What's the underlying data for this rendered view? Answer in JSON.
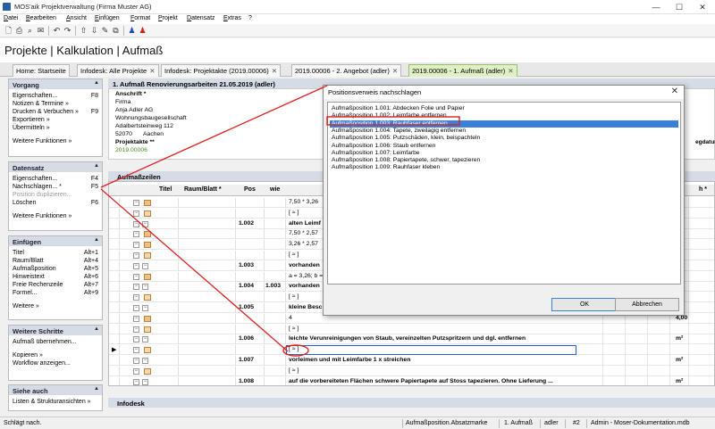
{
  "window": {
    "title": "MOS'aik Projektverwaltung (Firma Muster AG)",
    "min": "—",
    "max": "☐",
    "close": "✕"
  },
  "menu": [
    "Datei",
    "Bearbeiten",
    "Ansicht",
    "Einfügen",
    "Format",
    "Projekt",
    "Datensatz",
    "Extras",
    "?"
  ],
  "toolbar": {
    "icons": [
      "new-doc-icon",
      "print-icon",
      "preview-icon",
      "mail-icon",
      "undo-icon",
      "redo-icon",
      "arrow-up-icon",
      "arrow-down-icon",
      "edit-icon",
      "copy-icon",
      "user-blue-icon",
      "user-red-icon"
    ]
  },
  "app_title": "Projekte | Kalkulation | Aufmaß",
  "tabs": [
    {
      "label": "Home: Startseite",
      "close": ""
    },
    {
      "label": "Infodesk: Alle Projekte",
      "close": "✕"
    },
    {
      "label": "Infodesk: Projektakte (2019.00006)",
      "close": "✕"
    },
    {
      "label": "2019.00006 - 2. Angebot (adler)",
      "close": "✕"
    },
    {
      "label": "2019.00006 - 1. Aufmaß (adler)",
      "close": "✕"
    }
  ],
  "sidebar": {
    "vorgang": {
      "title": "Vorgang",
      "items": [
        {
          "label": "Eigenschaften...",
          "key": "F8"
        },
        {
          "label": "Notizen & Termine »",
          "key": ""
        },
        {
          "label": "Drucken & Verbuchen »",
          "key": "F9"
        },
        {
          "label": "Exportieren »",
          "key": ""
        },
        {
          "label": "Übermitteln »",
          "key": ""
        }
      ],
      "more": "Weitere Funktionen »"
    },
    "datensatz": {
      "title": "Datensatz",
      "items": [
        {
          "label": "Eigenschaften...",
          "key": "F4"
        },
        {
          "label": "Nachschlagen... *",
          "key": "F5"
        },
        {
          "label": "Position duplizieren...",
          "key": ""
        },
        {
          "label": "Löschen",
          "key": "F6"
        }
      ],
      "more": "Weitere Funktionen »"
    },
    "einfuegen": {
      "title": "Einfügen",
      "items": [
        {
          "label": "Titel",
          "key": "Alt+1"
        },
        {
          "label": "Raum/Blatt",
          "key": "Alt+4"
        },
        {
          "label": "Aufmaßposition",
          "key": "Alt+5"
        },
        {
          "label": "Hinweistext",
          "key": "Alt+6"
        },
        {
          "label": "Freie Rechenzeile",
          "key": "Alt+7"
        },
        {
          "label": "Formel...",
          "key": "Alt+9"
        }
      ],
      "more": "Weitere »"
    },
    "schritte": {
      "title": "Weitere Schritte",
      "items": [
        {
          "label": "Aufmaß übernehmen...",
          "key": ""
        },
        {
          "label": "Kopieren »",
          "key": ""
        },
        {
          "label": "Workflow anzeigen...",
          "key": ""
        }
      ]
    },
    "siehe": {
      "title": "Siehe auch",
      "items": [
        {
          "label": "Listen & Strukturansichten »",
          "key": ""
        }
      ]
    }
  },
  "main": {
    "header": "1. Aufmaß Renovierungsarbeiten 21.05.2019 (adler)",
    "address_label": "Anschrift *",
    "address_lines": [
      "Firma",
      "Anja Adler AG",
      "Wohnungsbaugesellschaft",
      "Adalbertsteinweg 112"
    ],
    "zip": "52070",
    "city": "Aachen",
    "project_label": "Projektakte **",
    "project_no": "2019.00006",
    "right_label": "egdatum",
    "section": "Aufmaßzeilen",
    "columns": [
      "Titel",
      "Raum/Blatt *",
      "Pos",
      "wie",
      "h *"
    ],
    "rows": [
      {
        "pos": "",
        "wie": "",
        "text": "7,50 * 3,26",
        "bold": false,
        "unit": ""
      },
      {
        "pos": "",
        "wie": "",
        "text": "[ ≈ ]",
        "bold": false,
        "unit": ""
      },
      {
        "pos": "1.002",
        "wie": "",
        "text": "alten Leimf",
        "bold": true,
        "unit": ""
      },
      {
        "pos": "",
        "wie": "",
        "text": "7,50 * 2,57",
        "bold": false,
        "unit": ""
      },
      {
        "pos": "",
        "wie": "",
        "text": "3,26 * 2,57",
        "bold": false,
        "unit": ""
      },
      {
        "pos": "",
        "wie": "",
        "text": "[ ≈ ]",
        "bold": false,
        "unit": ""
      },
      {
        "pos": "1.003",
        "wie": "",
        "text": "vorhanden",
        "bold": true,
        "unit": ""
      },
      {
        "pos": "",
        "wie": "",
        "text": "a = 3,26; b =",
        "bold": false,
        "unit": ""
      },
      {
        "pos": "1.004",
        "wie": "1.003",
        "text": "vorhanden",
        "bold": true,
        "unit": ""
      },
      {
        "pos": "",
        "wie": "",
        "text": "[ ≈ ]",
        "bold": false,
        "unit": ""
      },
      {
        "pos": "1.005",
        "wie": "",
        "text": "kleine Besc",
        "bold": true,
        "unit": ""
      },
      {
        "pos": "",
        "wie": "",
        "text": "4",
        "bold": false,
        "unit": "4,00"
      },
      {
        "pos": "",
        "wie": "",
        "text": "[ ≈ ]",
        "bold": false,
        "unit": ""
      },
      {
        "pos": "1.006",
        "wie": "",
        "text": "leichte Verunreinigungen von Staub, vereinzelten Putzspritzern und dgl. entfernen",
        "bold": true,
        "unit": "m²"
      },
      {
        "pos": "",
        "wie": "",
        "text": "[ ≈ ]",
        "bold": false,
        "unit": ""
      },
      {
        "pos": "1.007",
        "wie": "",
        "text": "vorleimen und mit Leimfarbe 1 x streichen",
        "bold": true,
        "unit": "m²"
      },
      {
        "pos": "",
        "wie": "",
        "text": "[ ≈ ]",
        "bold": false,
        "unit": ""
      },
      {
        "pos": "1.008",
        "wie": "",
        "text": "auf die vorbereiteten Flächen schwere Papiertapete auf Stoss tapezieren. Ohne Lieferung ...",
        "bold": true,
        "unit": "m²"
      }
    ],
    "infodesk": "Infodesk"
  },
  "dialog": {
    "title": "Positionsverweis nachschlagen",
    "close": "✕",
    "items": [
      "Aufmaßposition 1.001: Abdecken Folie und Papier",
      "Aufmaßposition 1.002: Leimfarbe entfernen",
      "Aufmaßposition 1.003: Rauhfaser entfernen",
      "Aufmaßposition 1.004: Tapete, zweilagig entfernen",
      "Aufmaßposition 1.005: Putzschäden, klein, beispachteln",
      "Aufmaßposition 1.006: Staub entfernen",
      "Aufmaßposition 1.007: Leimfarbe",
      "Aufmaßposition 1.008: Papiertapete, schwer, tapezieren",
      "Aufmaßposition 1.009: Rauhfaser kleben"
    ],
    "selected_index": 2,
    "ok": "OK",
    "cancel": "Abbrechen"
  },
  "status": {
    "left": "Schlägt nach.",
    "field": "Aufmaßposition.Absatzmarke",
    "doc": "1. Aufmaß",
    "user": "adler",
    "num": "#2",
    "db": "Admin - Moser-Dokumentation.mdb"
  },
  "colors": {
    "accent": "#3a7fd9",
    "panel_header": "#d6dce5",
    "active_tab": "#dff0c4",
    "callout": "#e02020"
  }
}
